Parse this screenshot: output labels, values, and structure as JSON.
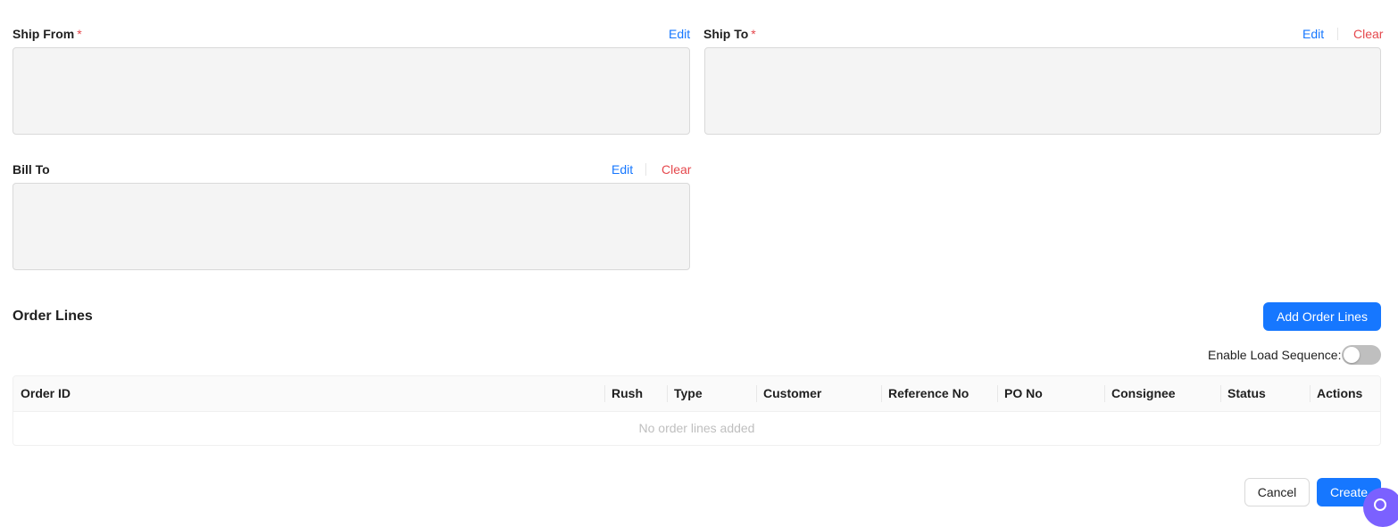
{
  "ship_from": {
    "label": "Ship From",
    "required": "*",
    "edit": "Edit"
  },
  "ship_to": {
    "label": "Ship To",
    "required": "*",
    "edit": "Edit",
    "clear": "Clear"
  },
  "bill_to": {
    "label": "Bill To",
    "edit": "Edit",
    "clear": "Clear"
  },
  "order_lines": {
    "title": "Order Lines",
    "add_button": "Add Order Lines",
    "load_sequence_label": "Enable Load Sequence:",
    "load_sequence_enabled": false,
    "columns": [
      "Order ID",
      "Rush",
      "Type",
      "Customer",
      "Reference No",
      "PO No",
      "Consignee",
      "Status",
      "Actions"
    ],
    "empty_text": "No order lines added"
  },
  "footer": {
    "cancel": "Cancel",
    "create": "Create"
  },
  "colors": {
    "primary": "#1677ff",
    "danger": "#e5484d",
    "fab": "#7b61ff"
  }
}
